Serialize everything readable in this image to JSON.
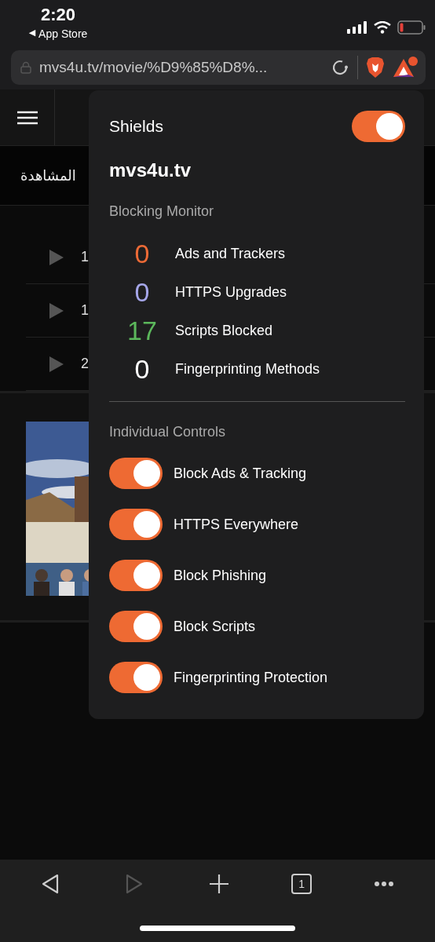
{
  "status_bar": {
    "time": "2:20",
    "back_arrow": "◀",
    "back_label": "App Store"
  },
  "address_bar": {
    "url": "mvs4u.tv/movie/%D9%85%D8%..."
  },
  "page": {
    "title": "المشاهدة",
    "rows": [
      {
        "text": "1"
      },
      {
        "text": "1"
      },
      {
        "text": "2"
      }
    ]
  },
  "shields": {
    "title": "Shields",
    "on": true,
    "domain": "mvs4u.tv",
    "monitor_heading": "Blocking Monitor",
    "stats": [
      {
        "count": "0",
        "label": "Ads and Trackers",
        "color": "#ec6a36"
      },
      {
        "count": "0",
        "label": "HTTPS Upgrades",
        "color": "#a5a6e8"
      },
      {
        "count": "17",
        "label": "Scripts Blocked",
        "color": "#5cb85c"
      },
      {
        "count": "0",
        "label": "Fingerprinting Methods",
        "color": "#ffffff"
      }
    ],
    "controls_heading": "Individual Controls",
    "controls": [
      {
        "label": "Block Ads & Tracking",
        "on": true
      },
      {
        "label": "HTTPS Everywhere",
        "on": true
      },
      {
        "label": "Block Phishing",
        "on": true
      },
      {
        "label": "Block Scripts",
        "on": true
      },
      {
        "label": "Fingerprinting Protection",
        "on": true
      }
    ]
  },
  "toolbar": {
    "buttons": [
      {
        "kind": "back",
        "disabled": false
      },
      {
        "kind": "forward",
        "disabled": true
      },
      {
        "kind": "add",
        "disabled": false
      },
      {
        "kind": "tabs",
        "count": "1",
        "disabled": false
      },
      {
        "kind": "more",
        "disabled": false
      }
    ]
  }
}
